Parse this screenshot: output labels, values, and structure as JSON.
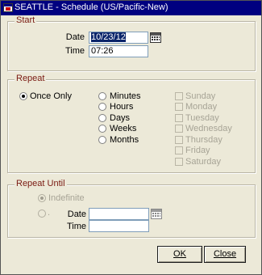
{
  "window": {
    "title": "SEATTLE - Schedule (US/Pacific-New)"
  },
  "start": {
    "legend": "Start",
    "date_label": "Date",
    "date_value": "10/23/12",
    "time_label": "Time",
    "time_value": "07:26"
  },
  "repeat": {
    "legend": "Repeat",
    "once_only": "Once Only",
    "options": [
      "Minutes",
      "Hours",
      "Days",
      "Weeks",
      "Months"
    ],
    "days": [
      "Sunday",
      "Monday",
      "Tuesday",
      "Wednesday",
      "Thursday",
      "Friday",
      "Saturday"
    ]
  },
  "repeat_until": {
    "legend": "Repeat Until",
    "indefinite": "Indefinite",
    "date_label": "Date",
    "date_value": "",
    "time_label": "Time",
    "time_value": ""
  },
  "buttons": {
    "ok": "OK",
    "close": "Close"
  },
  "colors": {
    "titlebar": "#000080",
    "group_legend": "#7a1a12",
    "face": "#ece9d8",
    "selection": "#0a246a"
  }
}
